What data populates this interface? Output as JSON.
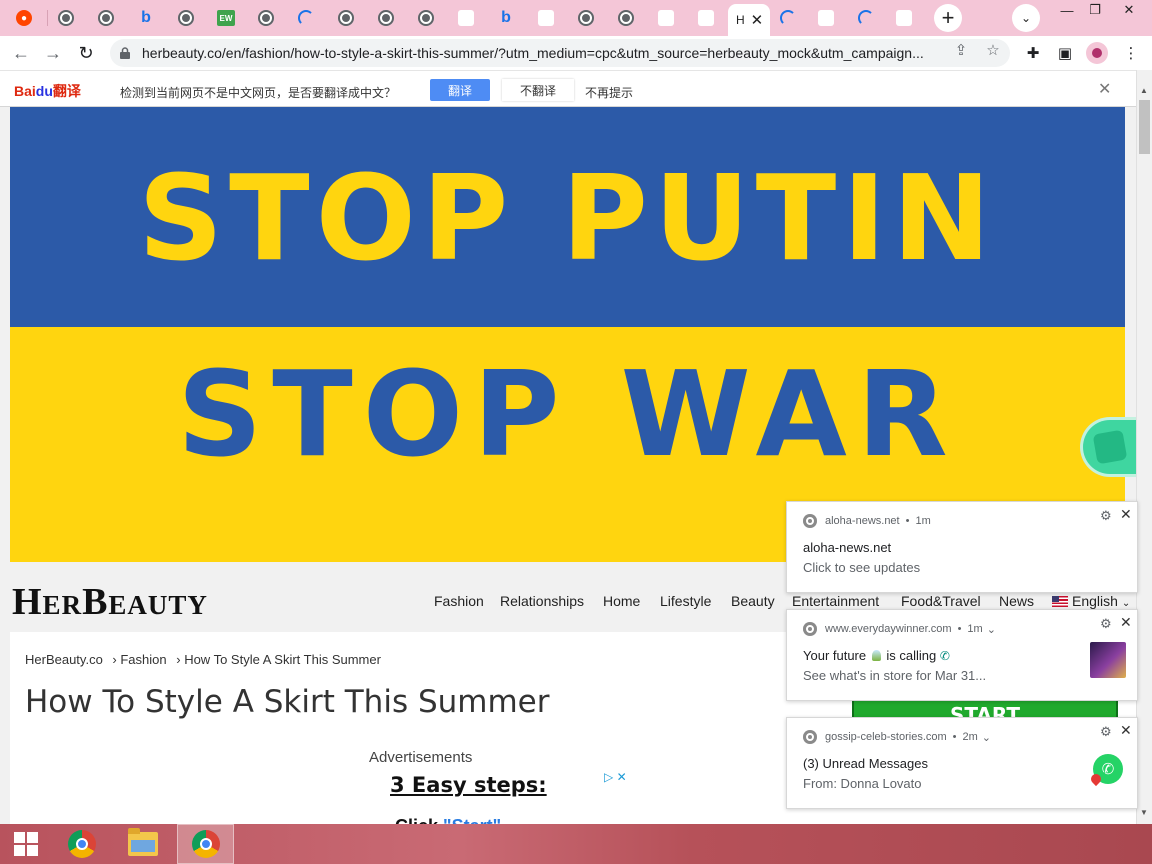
{
  "browser": {
    "active_tab_label": "H",
    "url": "herbeauty.co/en/fashion/how-to-style-a-skirt-this-summer/?utm_medium=cpc&utm_source=herbeauty_mock&utm_campaign..."
  },
  "translate_bar": {
    "logo_text_a": "Bai",
    "logo_text_b": "du",
    "logo_text_c": "翻译",
    "message": "检测到当前网页不是中文网页，是否要翻译成中文？",
    "translate_label": "翻译",
    "no_translate_label": "不翻译",
    "no_remind_label": "不再提示"
  },
  "banner": {
    "line1": "STOP PUTIN",
    "line2": "STOP WAR",
    "colors": {
      "blue": "#2c5aa8",
      "yellow": "#ffd50f"
    }
  },
  "site": {
    "logo": "HerBeauty",
    "nav": [
      "Fashion",
      "Relationships",
      "Home",
      "Lifestyle",
      "Beauty",
      "Entertainment",
      "Food&Travel",
      "News"
    ],
    "language": "English"
  },
  "article": {
    "breadcrumb": [
      "HerBeauty.co",
      "› Fashion",
      "› How To Style A Skirt This Summer"
    ],
    "title": "How To Style A Skirt This Summer",
    "ads_label": "Advertisements",
    "ad_heading": "3 Easy steps:",
    "ad_step_prefix": "Click",
    "ad_step_link": "\"Start\"",
    "start_label": "START"
  },
  "notifications": [
    {
      "source": "aloha-news.net",
      "time": "1m",
      "title": "aloha-news.net",
      "body": "Click to see updates"
    },
    {
      "source": "www.everydaywinner.com",
      "time": "1m",
      "title_a": "Your future",
      "title_b": "is calling",
      "body": "See what's in store for Mar 31..."
    },
    {
      "source": "gossip-celeb-stories.com",
      "time": "2m",
      "title": "(3) Unread Messages",
      "body": "From: Donna Lovato"
    }
  ]
}
